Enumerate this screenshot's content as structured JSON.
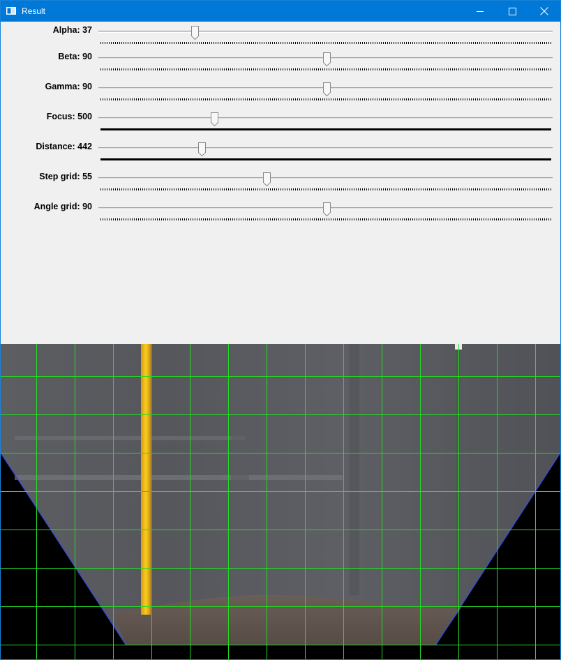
{
  "window": {
    "title": "Result",
    "controls": [
      "minimize",
      "maximize",
      "close"
    ]
  },
  "sliders": [
    {
      "label": "Alpha: 37",
      "name": "Alpha",
      "value": 37,
      "max": 180
    },
    {
      "label": "Beta: 90",
      "name": "Beta",
      "value": 90,
      "max": 180
    },
    {
      "label": "Gamma: 90",
      "name": "Gamma",
      "value": 90,
      "max": 180
    },
    {
      "label": "Focus: 500",
      "name": "Focus",
      "value": 500,
      "max": 2000
    },
    {
      "label": "Distance: 442",
      "name": "Distance",
      "value": 442,
      "max": 2000
    },
    {
      "label": "Step grid: 55",
      "name": "Step grid",
      "value": 55,
      "max": 150
    },
    {
      "label": "Angle grid: 90",
      "name": "Angle grid",
      "value": 90,
      "max": 180
    }
  ],
  "image": {
    "description": "",
    "grid_color": "#22dd22",
    "stripe_color": "#f4c416"
  },
  "colors": {
    "titlebar": "#0078d7",
    "panel": "#f0f0f0"
  }
}
